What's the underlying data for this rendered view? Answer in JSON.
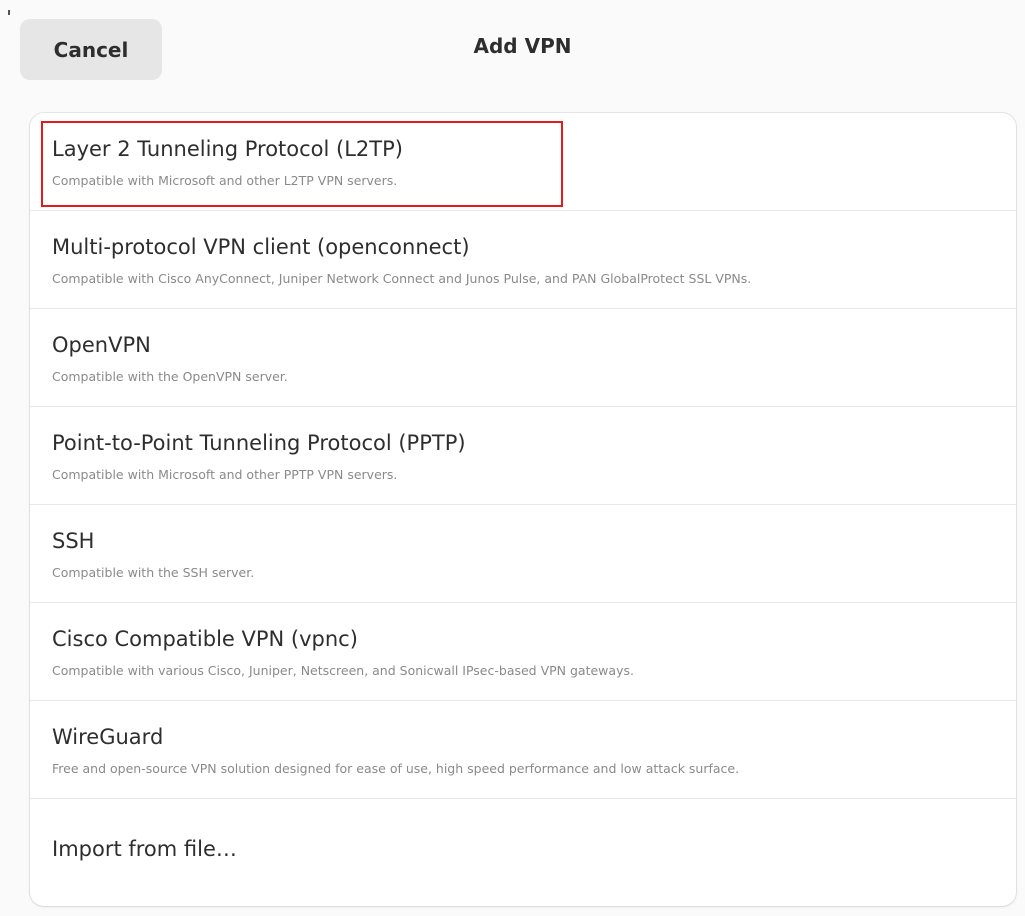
{
  "header": {
    "cancel_label": "Cancel",
    "title": "Add VPN"
  },
  "vpn_types": [
    {
      "title": "Layer 2 Tunneling Protocol (L2TP)",
      "subtitle": "Compatible with Microsoft and other L2TP VPN servers."
    },
    {
      "title": "Multi-protocol VPN client (openconnect)",
      "subtitle": "Compatible with Cisco AnyConnect, Juniper Network Connect and Junos Pulse, and PAN GlobalProtect SSL VPNs."
    },
    {
      "title": "OpenVPN",
      "subtitle": "Compatible with the OpenVPN server."
    },
    {
      "title": "Point-to-Point Tunneling Protocol (PPTP)",
      "subtitle": "Compatible with Microsoft and other PPTP VPN servers."
    },
    {
      "title": "SSH",
      "subtitle": "Compatible with the SSH server."
    },
    {
      "title": "Cisco Compatible VPN (vpnc)",
      "subtitle": "Compatible with various Cisco, Juniper, Netscreen, and Sonicwall IPsec-based VPN gateways."
    },
    {
      "title": "WireGuard",
      "subtitle": "Free and open-source VPN solution designed for ease of use, high speed performance and low attack surface."
    }
  ],
  "import": {
    "label": "Import from file…"
  },
  "colors": {
    "highlight": "#e41b1b",
    "background": "#fafafa",
    "card": "#ffffff"
  }
}
